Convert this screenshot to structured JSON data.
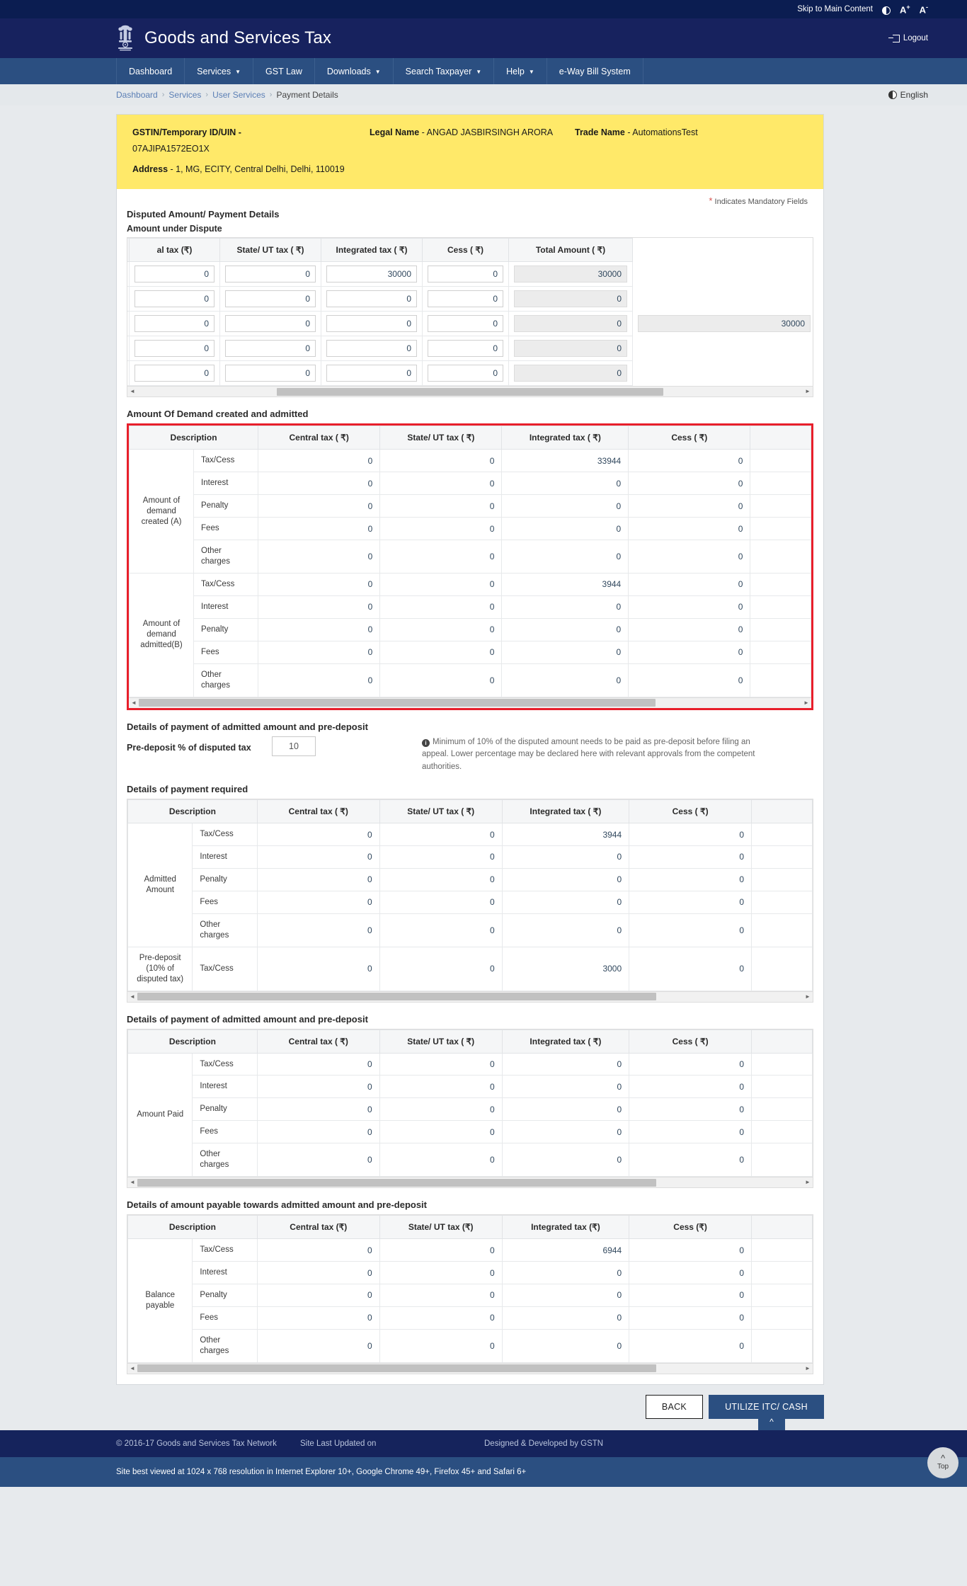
{
  "utility": {
    "skip_link": "Skip to Main Content",
    "contrast_icon": "contrast-toggle-icon",
    "font_increase": "A",
    "font_increase_sup": "+",
    "font_decrease": "A",
    "font_decrease_sup": "-"
  },
  "header": {
    "emblem": "india-emblem-icon",
    "title": "Goods and Services Tax",
    "logout": "Logout"
  },
  "nav": [
    {
      "label": "Dashboard",
      "has_caret": false
    },
    {
      "label": "Services",
      "has_caret": true
    },
    {
      "label": "GST Law",
      "has_caret": false
    },
    {
      "label": "Downloads",
      "has_caret": true
    },
    {
      "label": "Search Taxpayer",
      "has_caret": true
    },
    {
      "label": "Help",
      "has_caret": true
    },
    {
      "label": "e-Way Bill System",
      "has_caret": false
    }
  ],
  "breadcrumb": {
    "items": [
      "Dashboard",
      "Services",
      "User Services",
      "Payment Details"
    ],
    "language": "English"
  },
  "taxpayer": {
    "gstin_label": "GSTIN/Temporary ID/UIN -",
    "gstin_value": "07AJIPA1572EO1X",
    "legal_name_label": "Legal Name",
    "legal_name_value": "- ANGAD JASBIRSINGH ARORA",
    "trade_name_label": "Trade Name",
    "trade_name_value": "- AutomationsTest",
    "address_label": "Address",
    "address_value": "- 1, MG, ECITY, Central Delhi, Delhi, 110019"
  },
  "mandatory_note": "Indicates Mandatory Fields",
  "section_disputed": {
    "title": "Disputed Amount/ Payment Details",
    "subtitle": "Amount under Dispute",
    "headers": [
      "al tax (₹)",
      "State/ UT tax ( ₹)",
      "Integrated tax ( ₹)",
      "Cess ( ₹)",
      "Total Amount ( ₹)"
    ],
    "rows": [
      {
        "central": "0",
        "state": "0",
        "integrated": "30000",
        "cess": "0",
        "total": "30000",
        "grand": ""
      },
      {
        "central": "0",
        "state": "0",
        "integrated": "0",
        "cess": "0",
        "total": "0",
        "grand": ""
      },
      {
        "central": "0",
        "state": "0",
        "integrated": "0",
        "cess": "0",
        "total": "0",
        "grand": "30000"
      },
      {
        "central": "0",
        "state": "0",
        "integrated": "0",
        "cess": "0",
        "total": "0",
        "grand": ""
      },
      {
        "central": "0",
        "state": "0",
        "integrated": "0",
        "cess": "0",
        "total": "0",
        "grand": ""
      }
    ]
  },
  "section_demand": {
    "title": "Amount Of Demand created and admitted",
    "headers": [
      "Description",
      "Central tax ( ₹)",
      "State/ UT tax ( ₹)",
      "Integrated tax ( ₹)",
      "Cess ( ₹)",
      ""
    ],
    "group_a_label": "Amount of demand created (A)",
    "group_b_label": "Amount of demand admitted(B)",
    "group_a": [
      {
        "label": "Tax/Cess",
        "central": "0",
        "state": "0",
        "integrated": "33944",
        "cess": "0"
      },
      {
        "label": "Interest",
        "central": "0",
        "state": "0",
        "integrated": "0",
        "cess": "0"
      },
      {
        "label": "Penalty",
        "central": "0",
        "state": "0",
        "integrated": "0",
        "cess": "0"
      },
      {
        "label": "Fees",
        "central": "0",
        "state": "0",
        "integrated": "0",
        "cess": "0"
      },
      {
        "label": "Other charges",
        "central": "0",
        "state": "0",
        "integrated": "0",
        "cess": "0"
      }
    ],
    "group_b": [
      {
        "label": "Tax/Cess",
        "central": "0",
        "state": "0",
        "integrated": "3944",
        "cess": "0"
      },
      {
        "label": "Interest",
        "central": "0",
        "state": "0",
        "integrated": "0",
        "cess": "0"
      },
      {
        "label": "Penalty",
        "central": "0",
        "state": "0",
        "integrated": "0",
        "cess": "0"
      },
      {
        "label": "Fees",
        "central": "0",
        "state": "0",
        "integrated": "0",
        "cess": "0"
      },
      {
        "label": "Other charges",
        "central": "0",
        "state": "0",
        "integrated": "0",
        "cess": "0"
      }
    ]
  },
  "section_predeposit": {
    "title": "Details of payment of admitted amount and pre-deposit",
    "percent_label": "Pre-deposit % of disputed tax",
    "percent_value": "10",
    "note": "Minimum of 10% of the disputed amount needs to be paid as pre-deposit before filing an appeal. Lower percentage may be declared here with relevant approvals from the competent authorities."
  },
  "section_required": {
    "title": "Details of payment required",
    "headers": [
      "Description",
      "Central tax ( ₹)",
      "State/ UT tax ( ₹)",
      "Integrated tax ( ₹)",
      "Cess ( ₹)",
      ""
    ],
    "group_label": "Admitted Amount",
    "rows": [
      {
        "label": "Tax/Cess",
        "central": "0",
        "state": "0",
        "integrated": "3944",
        "cess": "0"
      },
      {
        "label": "Interest",
        "central": "0",
        "state": "0",
        "integrated": "0",
        "cess": "0"
      },
      {
        "label": "Penalty",
        "central": "0",
        "state": "0",
        "integrated": "0",
        "cess": "0"
      },
      {
        "label": "Fees",
        "central": "0",
        "state": "0",
        "integrated": "0",
        "cess": "0"
      },
      {
        "label": "Other charges",
        "central": "0",
        "state": "0",
        "integrated": "0",
        "cess": "0"
      }
    ],
    "predeposit_label": "Pre-deposit (10% of disputed tax)",
    "predeposit_row": {
      "label": "Tax/Cess",
      "central": "0",
      "state": "0",
      "integrated": "3000",
      "cess": "0"
    }
  },
  "section_paid": {
    "title": "Details of payment of admitted amount and pre-deposit",
    "headers": [
      "Description",
      "Central tax ( ₹)",
      "State/ UT tax ( ₹)",
      "Integrated tax ( ₹)",
      "Cess ( ₹)",
      ""
    ],
    "group_label": "Amount Paid",
    "rows": [
      {
        "label": "Tax/Cess",
        "central": "0",
        "state": "0",
        "integrated": "0",
        "cess": "0"
      },
      {
        "label": "Interest",
        "central": "0",
        "state": "0",
        "integrated": "0",
        "cess": "0"
      },
      {
        "label": "Penalty",
        "central": "0",
        "state": "0",
        "integrated": "0",
        "cess": "0"
      },
      {
        "label": "Fees",
        "central": "0",
        "state": "0",
        "integrated": "0",
        "cess": "0"
      },
      {
        "label": "Other charges",
        "central": "0",
        "state": "0",
        "integrated": "0",
        "cess": "0"
      }
    ]
  },
  "section_payable": {
    "title": "Details of amount payable towards admitted amount and pre-deposit",
    "headers": [
      "Description",
      "Central tax (₹)",
      "State/ UT tax (₹)",
      "Integrated tax (₹)",
      "Cess (₹)",
      ""
    ],
    "group_label": "Balance payable",
    "rows": [
      {
        "label": "Tax/Cess",
        "central": "0",
        "state": "0",
        "integrated": "6944",
        "cess": "0"
      },
      {
        "label": "Interest",
        "central": "0",
        "state": "0",
        "integrated": "0",
        "cess": "0"
      },
      {
        "label": "Penalty",
        "central": "0",
        "state": "0",
        "integrated": "0",
        "cess": "0"
      },
      {
        "label": "Fees",
        "central": "0",
        "state": "0",
        "integrated": "0",
        "cess": "0"
      },
      {
        "label": "Other charges",
        "central": "0",
        "state": "0",
        "integrated": "0",
        "cess": "0"
      }
    ]
  },
  "actions": {
    "back": "BACK",
    "utilize": "UTILIZE ITC/ CASH"
  },
  "footer": {
    "copyright": "© 2016-17 Goods and Services Tax Network",
    "last_updated": "Site Last Updated on",
    "designed": "Designed & Developed by GSTN",
    "best_viewed": "Site best viewed at 1024 x 768 resolution in Internet Explorer 10+, Google Chrome 49+, Firefox 45+ and Safari 6+",
    "to_top": "Top"
  },
  "colors": {
    "masthead": "#17225e",
    "nav": "#2b4f81",
    "taxpayer_bar": "#ffe969",
    "highlight_border": "#e81f2b",
    "primary_button": "#2b4f81"
  }
}
